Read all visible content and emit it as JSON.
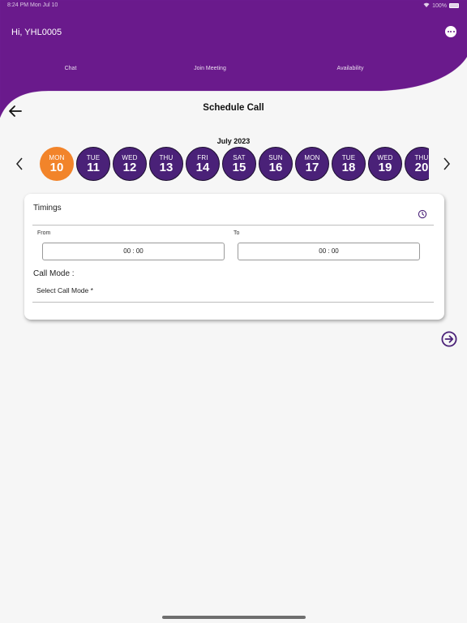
{
  "status_bar": {
    "time_date": "8:24 PM  Mon Jul 10",
    "battery": "100%"
  },
  "header": {
    "greeting": "Hi, YHL0005",
    "tabs": [
      {
        "label": "Chat"
      },
      {
        "label": "Join Meeting"
      },
      {
        "label": "Availability"
      }
    ]
  },
  "page": {
    "title": "Schedule Call",
    "month": "July 2023"
  },
  "dates": [
    {
      "dow": "MON",
      "day": "10",
      "selected": true
    },
    {
      "dow": "TUE",
      "day": "11",
      "selected": false
    },
    {
      "dow": "WED",
      "day": "12",
      "selected": false
    },
    {
      "dow": "THU",
      "day": "13",
      "selected": false
    },
    {
      "dow": "FRI",
      "day": "14",
      "selected": false
    },
    {
      "dow": "SAT",
      "day": "15",
      "selected": false
    },
    {
      "dow": "SUN",
      "day": "16",
      "selected": false
    },
    {
      "dow": "MON",
      "day": "17",
      "selected": false
    },
    {
      "dow": "TUE",
      "day": "18",
      "selected": false
    },
    {
      "dow": "WED",
      "day": "19",
      "selected": false
    },
    {
      "dow": "THU",
      "day": "20",
      "selected": false
    }
  ],
  "timings": {
    "label": "Timings",
    "from_label": "From",
    "from_value": "00 : 00",
    "to_label": "To",
    "to_value": "00 : 00"
  },
  "call_mode": {
    "label": "Call Mode :",
    "select_placeholder": "Select Call Mode *"
  },
  "colors": {
    "header_purple": "#6a1a8c",
    "date_purple": "#4a2178",
    "selected_orange": "#f2842a",
    "accent": "#4a2178"
  },
  "icons": {
    "back": "arrow-left-icon",
    "more": "more-dots-icon",
    "prev": "chevron-left-icon",
    "next_dates": "chevron-right-icon",
    "clock": "clock-icon",
    "next": "arrow-circle-right-icon"
  }
}
